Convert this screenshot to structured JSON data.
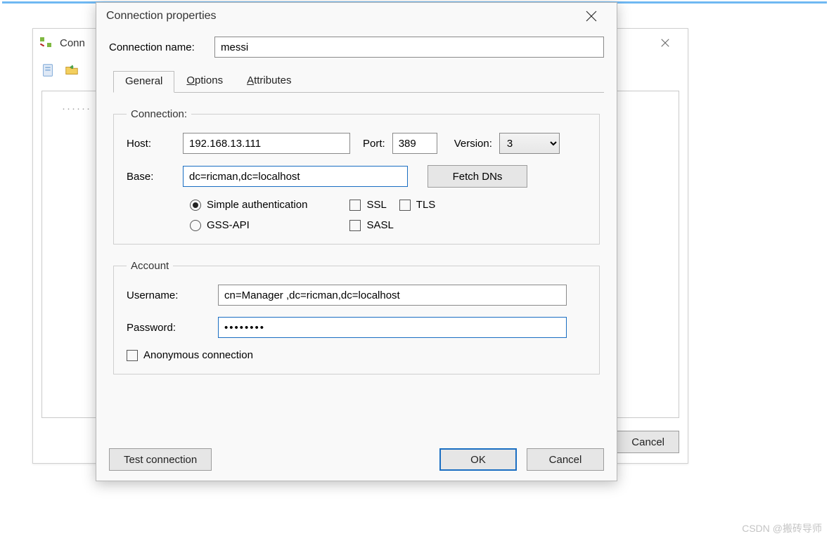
{
  "background_window": {
    "title_truncated": "Conn",
    "cancel_label": "Cancel"
  },
  "dialog": {
    "title": "Connection properties",
    "connection_name_label": "Connection name:",
    "connection_name_value": "messi",
    "tabs": {
      "general": "General",
      "options": "Options",
      "attributes": "Attributes"
    },
    "connection_group": {
      "legend": "Connection:",
      "host_label": "Host:",
      "host_value": "192.168.13.111",
      "port_label": "Port:",
      "port_value": "389",
      "version_label": "Version:",
      "version_value": "3",
      "base_label": "Base:",
      "base_value": "dc=ricman,dc=localhost",
      "fetch_label": "Fetch DNs",
      "simple_auth_label": "Simple authentication",
      "gss_api_label": "GSS-API",
      "ssl_label": "SSL",
      "tls_label": "TLS",
      "sasl_label": "SASL"
    },
    "account_group": {
      "legend": "Account",
      "username_label": "Username:",
      "username_value": "cn=Manager ,dc=ricman,dc=localhost",
      "password_label": "Password:",
      "password_value": "••••••••",
      "anonymous_label": "Anonymous connection"
    },
    "buttons": {
      "test": "Test connection",
      "ok": "OK",
      "cancel": "Cancel"
    }
  },
  "watermark": "CSDN @搬砖导师"
}
